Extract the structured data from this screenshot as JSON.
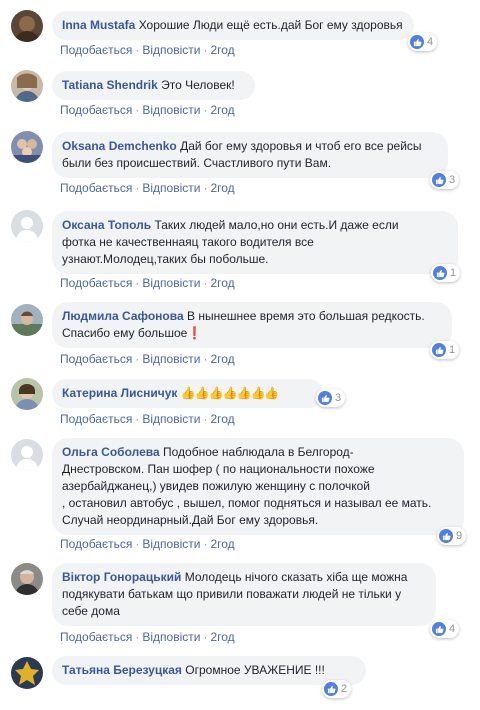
{
  "actions": {
    "like": "Подобається",
    "reply": "Відповісти",
    "dot": "·"
  },
  "comments": [
    {
      "name": "Inna Mustafa",
      "text": "Хорошие Люди ещё есть.дай Бог ему здоровья",
      "time": "2год",
      "reactions": "4"
    },
    {
      "name": "Tatiana Shendrik",
      "text": "Это Человек!",
      "time": "2год",
      "reactions": ""
    },
    {
      "name": "Oksana Demchenko",
      "text_lines": [
        "Дай бог ему здоровья и чтоб его все рейсы",
        "были без происшествий. Счастливого пути Вам."
      ],
      "time": "2год",
      "reactions": "3"
    },
    {
      "name": "Оксана Тополь",
      "text_lines": [
        "Таких людей мало,но они есть.И даже если",
        "фотка не качественнаяц такого водителя все",
        "узнают.Молодец,таких бы побольше."
      ],
      "time": "2год",
      "reactions": "1"
    },
    {
      "name": "Людмила Сафонова",
      "text_lines": [
        "В нынешнее время это большая редкость.",
        "Спасибо ему большое❗"
      ],
      "time": "2год",
      "reactions": "1"
    },
    {
      "name": "Катерина Лисничук",
      "text": "👍👍👍👍👍👍👍",
      "time": "2год",
      "reactions": "3"
    },
    {
      "name": "Ольга Соболева",
      "text_lines": [
        "Подобное наблюдала в Белгород-",
        "Днестровском. Пан шофер ( по национальности похоже",
        "азербайджанец,) увидев пожилую женщину с полочкой",
        ", остановил автобус , вышел, помог подняться и называл ее мать.",
        "Случай неординарный.Дай Бог ему здоровья."
      ],
      "time": "2год",
      "reactions": "9"
    },
    {
      "name": "Віктор Гонорацький",
      "text_lines": [
        "Молодець нічого сказать хіба ще можна",
        "подякувати батькам що привили поважати людей не тільки у",
        "себе дома"
      ],
      "time": "2год",
      "reactions": "4"
    },
    {
      "name": "Татьяна Березуцкая",
      "text": "Огромное УВАЖЕНИЕ !!!",
      "time": "",
      "reactions": "2"
    }
  ],
  "colors": {
    "name": "#385898",
    "link": "#4b67a1",
    "bubble": "#f2f3f5",
    "like": "#4f7fe0"
  }
}
